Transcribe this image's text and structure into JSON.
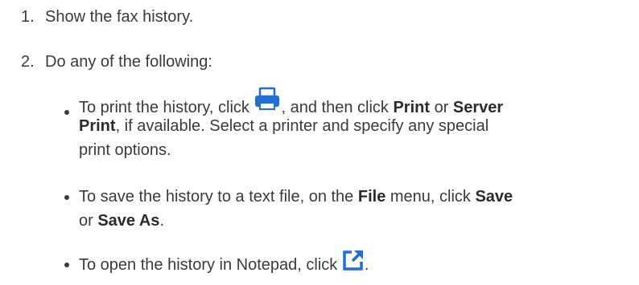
{
  "steps": [
    {
      "number": "1.",
      "text": "Show the fax history."
    },
    {
      "number": "2.",
      "text": "Do any of the following:"
    }
  ],
  "bullets": {
    "print": {
      "t1": "To print the history, click ",
      "t2": ", and then click ",
      "b1": "Print",
      "t3": " or ",
      "b2": "Server",
      "b3": "Print",
      "t4": ", if available. Select a printer and specify any special",
      "t5": "print options."
    },
    "save": {
      "t1": "To save the history to a text file, on the ",
      "b1": "File",
      "t2": " menu, click ",
      "b2": "Save",
      "t3": "or ",
      "b3": "Save As",
      "t4": "."
    },
    "notepad": {
      "t1": "To open the history in Notepad, click ",
      "t2": "."
    }
  },
  "icons": {
    "print": "printer-icon",
    "notepad": "open-external-icon",
    "accent": "#1e6fd9"
  }
}
